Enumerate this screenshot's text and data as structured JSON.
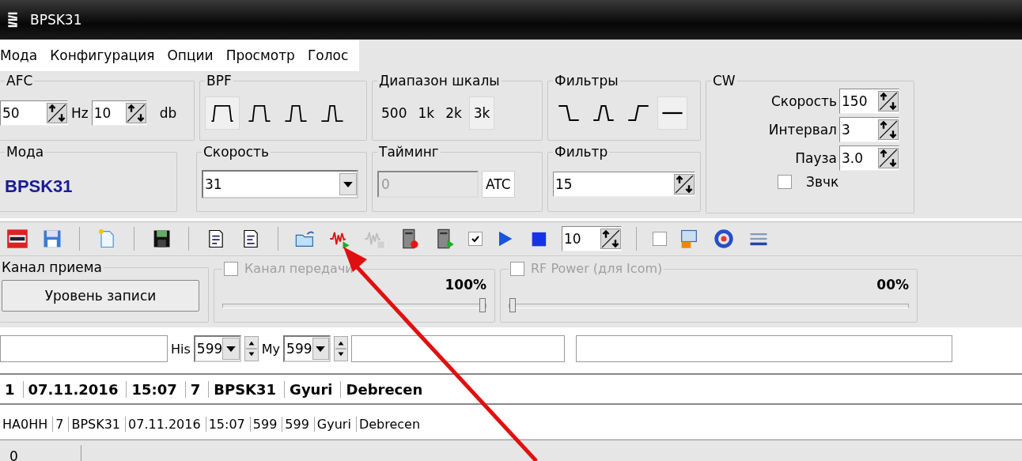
{
  "window": {
    "title": "BPSK31"
  },
  "menu": [
    "Мода",
    "Конфигурация",
    "Опции",
    "Просмотр",
    "Голос"
  ],
  "afc": {
    "title": "AFC",
    "hz_value": "50",
    "hz_unit": "Hz",
    "db_value": "10",
    "db_unit": "db"
  },
  "bpf": {
    "title": "BPF",
    "options": [
      {
        "selected": true
      },
      {
        "selected": false
      },
      {
        "selected": false
      },
      {
        "selected": false
      }
    ]
  },
  "scale_range": {
    "title": "Диапазон шкалы",
    "options": [
      {
        "label": "500",
        "selected": false
      },
      {
        "label": "1k",
        "selected": false
      },
      {
        "label": "2k",
        "selected": false
      },
      {
        "label": "3k",
        "selected": true
      }
    ]
  },
  "filters": {
    "title": "Фильтры",
    "options": [
      {
        "kind": "lowpass",
        "selected": false
      },
      {
        "kind": "bandpass",
        "selected": false
      },
      {
        "kind": "highpass",
        "selected": false
      },
      {
        "kind": "flat",
        "selected": true
      }
    ]
  },
  "cw": {
    "title": "CW",
    "fields": [
      {
        "label": "Скорость",
        "value": "150"
      },
      {
        "label": "Интервал",
        "value": "3"
      },
      {
        "label": "Пауза",
        "value": "3.0"
      }
    ],
    "sound": {
      "label": "Звчк",
      "checked": false
    }
  },
  "mode": {
    "title": "Мода",
    "value": "BPSK31"
  },
  "speed": {
    "title": "Скорость",
    "value": "31"
  },
  "timing": {
    "title": "Тайминг",
    "value": "0",
    "button": "ATC"
  },
  "filter": {
    "title": "Фильтр",
    "value": "15"
  },
  "toolbar": [
    {
      "kind": "button",
      "disabled": false
    },
    {
      "kind": "button",
      "disabled": false
    },
    {
      "kind": "button",
      "disabled": false
    },
    {
      "kind": "button",
      "disabled": false
    },
    {
      "kind": "button",
      "disabled": false
    },
    {
      "kind": "button",
      "disabled": false
    },
    {
      "kind": "button",
      "disabled": false
    },
    {
      "kind": "button",
      "disabled": false
    },
    {
      "kind": "button",
      "disabled": true
    },
    {
      "kind": "button",
      "disabled": false
    },
    {
      "kind": "button",
      "disabled": false
    },
    {
      "kind": "checkbox",
      "checked": true
    },
    {
      "kind": "button",
      "disabled": false
    },
    {
      "kind": "button",
      "disabled": false
    },
    {
      "kind": "spin",
      "value": "10"
    },
    {
      "kind": "checkbox",
      "checked": false
    },
    {
      "kind": "button",
      "disabled": false
    },
    {
      "kind": "button",
      "disabled": false
    },
    {
      "kind": "button",
      "disabled": false
    }
  ],
  "rx_channel": {
    "title": "Канал приема",
    "button": "Уровень записи"
  },
  "tx_channel": {
    "title": "Канал передачи",
    "checked": false,
    "reading": "100%",
    "level": 1.0
  },
  "rf_power": {
    "title": "RF Power (для Icom)",
    "checked": false,
    "reading": "00%",
    "level": 0.0
  },
  "report": {
    "his_label": "His",
    "his_value": "599",
    "my_label": "My",
    "my_value": "599"
  },
  "log_header": [
    "1",
    "07.11.2016",
    "15:07",
    "7",
    "BPSK31",
    "Gyuri",
    "Debrecen"
  ],
  "log_row": [
    "HA0HH",
    "7",
    "BPSK31",
    "07.11.2016",
    "15:07",
    "599",
    "599",
    "Gyuri",
    "Debrecen"
  ],
  "status_bar": [
    "0"
  ]
}
